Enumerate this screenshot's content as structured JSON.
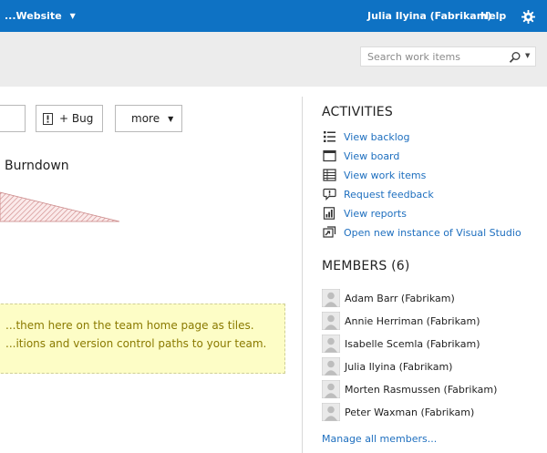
{
  "topbar": {
    "project": "...Website",
    "user": "Julia Ilyina (Fabrikam)",
    "help": "Help",
    "settings_icon": "gear-icon",
    "accent": "#0e72c4"
  },
  "search": {
    "placeholder": "Search work items"
  },
  "toolbar": {
    "bug_label": "+ Bug",
    "more_label": "more"
  },
  "burndown": {
    "title": "Burndown"
  },
  "tip": {
    "line1": "...them here on the team home page as tiles.",
    "line2": "...itions and version control paths to your team."
  },
  "activities": {
    "heading": "ACTIVITIES",
    "items": [
      {
        "label": "View backlog",
        "icon": "backlog-list-icon"
      },
      {
        "label": "View board",
        "icon": "board-icon"
      },
      {
        "label": "View work items",
        "icon": "work-items-icon"
      },
      {
        "label": "Request feedback",
        "icon": "feedback-icon"
      },
      {
        "label": "View reports",
        "icon": "reports-icon"
      },
      {
        "label": "Open new instance of Visual Studio",
        "icon": "visual-studio-icon"
      }
    ]
  },
  "members": {
    "heading": "MEMBERS (6)",
    "items": [
      {
        "name": "Adam Barr (Fabrikam)"
      },
      {
        "name": "Annie Herriman (Fabrikam)"
      },
      {
        "name": "Isabelle Scemla (Fabrikam)"
      },
      {
        "name": "Julia Ilyina (Fabrikam)"
      },
      {
        "name": "Morten Rasmussen (Fabrikam)"
      },
      {
        "name": "Peter Waxman (Fabrikam)"
      }
    ],
    "manage_link": "Manage all members..."
  }
}
